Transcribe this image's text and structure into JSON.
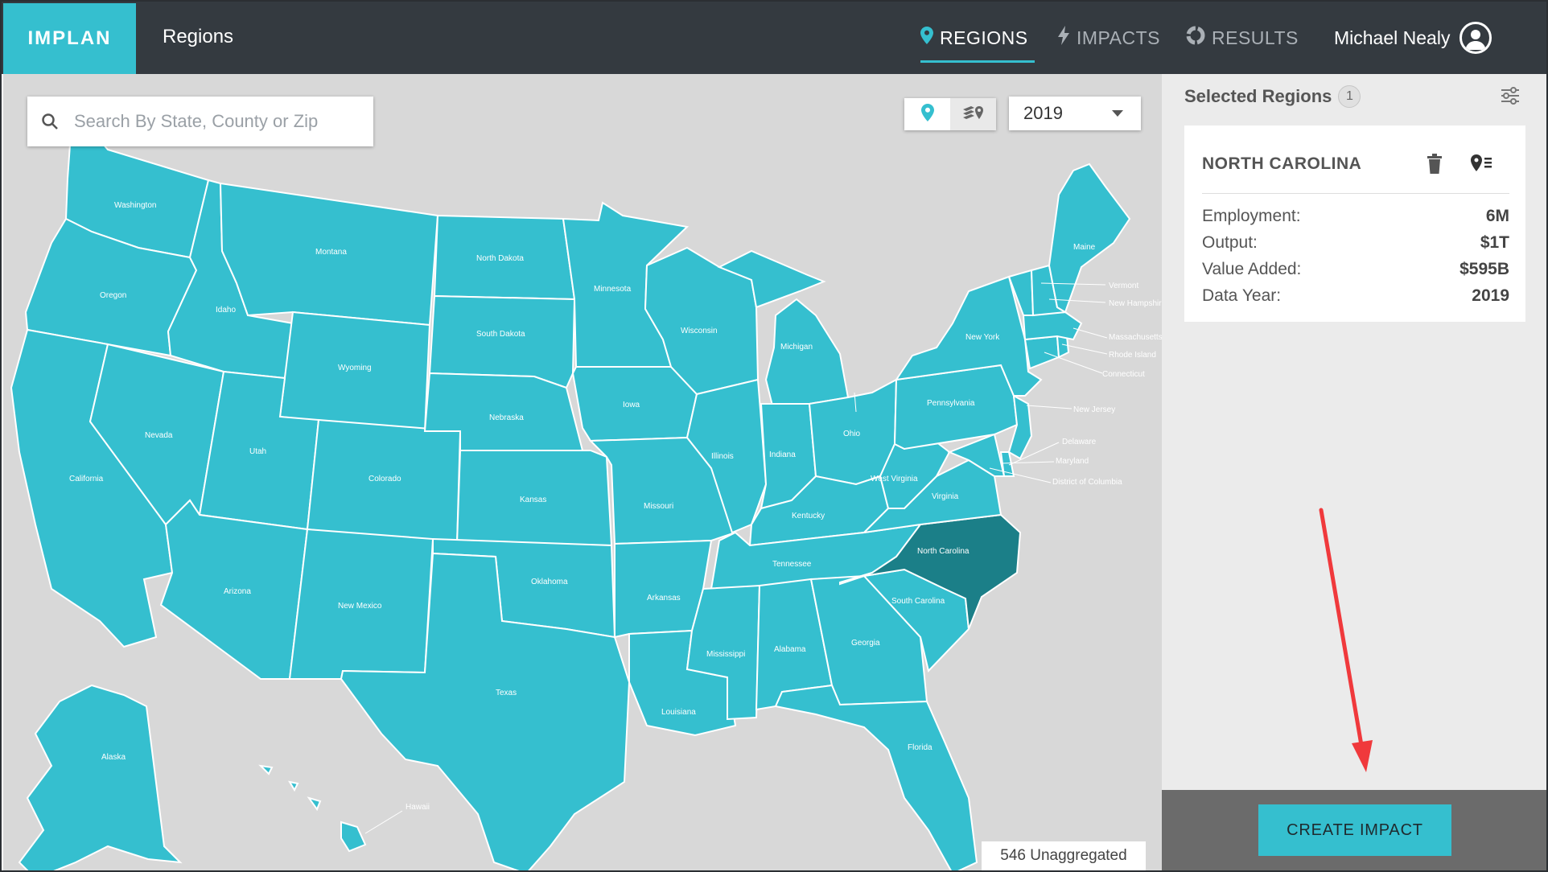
{
  "app": {
    "logo": "IMPLAN",
    "page_title": "Regions"
  },
  "nav": {
    "regions": "REGIONS",
    "impacts": "IMPACTS",
    "results": "RESULTS",
    "active": "regions"
  },
  "user": {
    "name": "Michael Nealy"
  },
  "map": {
    "search_placeholder": "Search By State, County or Zip",
    "year": "2019",
    "unaggregated": "546 Unaggregated",
    "selected_state": "North Carolina",
    "colors": {
      "state": "#35bfcf",
      "selected": "#1b7f88",
      "background": "#d8d8d8"
    },
    "labels": {
      "washington": "Washington",
      "oregon": "Oregon",
      "california": "California",
      "idaho": "Idaho",
      "nevada": "Nevada",
      "montana": "Montana",
      "wyoming": "Wyoming",
      "utah": "Utah",
      "arizona": "Arizona",
      "colorado": "Colorado",
      "new_mexico": "New Mexico",
      "north_dakota": "North Dakota",
      "south_dakota": "South Dakota",
      "nebraska": "Nebraska",
      "kansas": "Kansas",
      "oklahoma": "Oklahoma",
      "texas": "Texas",
      "minnesota": "Minnesota",
      "iowa": "Iowa",
      "missouri": "Missouri",
      "arkansas": "Arkansas",
      "louisiana": "Louisiana",
      "wisconsin": "Wisconsin",
      "illinois": "Illinois",
      "michigan": "Michigan",
      "indiana": "Indiana",
      "ohio": "Ohio",
      "kentucky": "Kentucky",
      "tennessee": "Tennessee",
      "mississippi": "Mississippi",
      "alabama": "Alabama",
      "georgia": "Georgia",
      "florida": "Florida",
      "south_carolina": "South Carolina",
      "north_carolina": "North Carolina",
      "virginia": "Virginia",
      "west_virginia": "West Virginia",
      "pennsylvania": "Pennsylvania",
      "new_york": "New York",
      "maine": "Maine",
      "vermont": "Vermont",
      "new_hampshire": "New Hampshire",
      "massachusetts": "Massachusetts",
      "rhode_island": "Rhode Island",
      "connecticut": "Connecticut",
      "new_jersey": "New Jersey",
      "delaware": "Delaware",
      "maryland": "Maryland",
      "dc": "District of Columbia",
      "alaska": "Alaska",
      "hawaii": "Hawaii"
    }
  },
  "panel": {
    "header": "Selected Regions",
    "count": "1",
    "region": {
      "name": "NORTH CAROLINA",
      "employment_label": "Employment:",
      "employment_value": "6M",
      "output_label": "Output:",
      "output_value": "$1T",
      "value_added_label": "Value Added:",
      "value_added_value": "$595B",
      "data_year_label": "Data Year:",
      "data_year_value": "2019"
    },
    "create_button": "CREATE IMPACT"
  }
}
